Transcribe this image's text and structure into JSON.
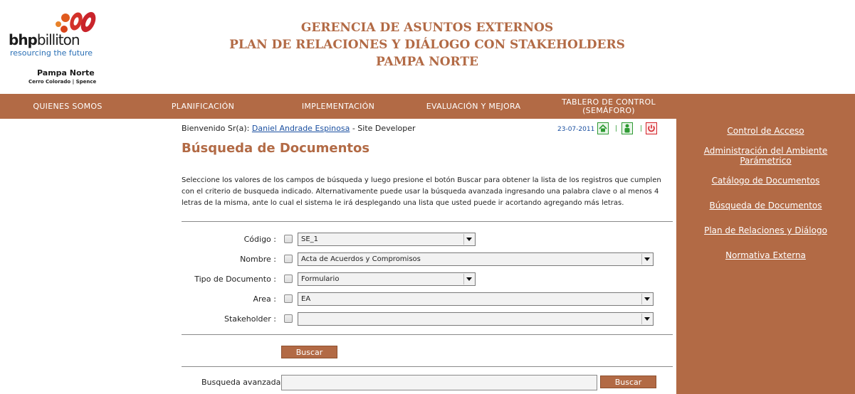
{
  "brand": {
    "logo_word_bold": "bhp",
    "logo_word_rest": "billiton",
    "tagline": "resourcing the future",
    "site_name": "Pampa Norte",
    "site_sub": "Cerro Colorado | Spence"
  },
  "header": {
    "title_line1": "GERENCIA DE ASUNTOS EXTERNOS",
    "title_line2": "PLAN DE RELACIONES Y DIÁLOGO CON STAKEHOLDERS",
    "title_line3": "PAMPA NORTE"
  },
  "nav": {
    "quienes": "QUIENES SOMOS",
    "planificacion": "PLANIFICACIÓN",
    "implementacion": "IMPLEMENTACIÓN",
    "evaluacion": "EVALUACIÓN Y MEJORA",
    "tablero_line1": "TABLERO DE CONTROL",
    "tablero_line2": "(SEMÁFORO)"
  },
  "user": {
    "greeting": "Bienvenido Sr(a):",
    "name": "Daniel Andrade Espinosa",
    "role": "- Site Developer",
    "date": "23-07-2011"
  },
  "toolbar": {
    "separator": "|",
    "icons": [
      "home-icon",
      "user-icon",
      "power-icon"
    ]
  },
  "page": {
    "title": "Búsqueda de Documentos",
    "description": "Seleccione los valores de los campos de búsqueda y luego presione el botón Buscar para obtener la lista de los registros que cumplen con el criterio de busqueda indicado. Alternativamente puede usar la búsqueda avanzada ingresando una palabra clave o al menos 4 letras de la misma, ante lo cual el sistema le irá desplegando una lista que usted puede ir acortando agregando más letras."
  },
  "form": {
    "codigo_label": "Código :",
    "codigo_value": "SE_1",
    "nombre_label": "Nombre :",
    "nombre_value": "Acta de Acuerdos y Compromisos",
    "tipo_label": "Tipo de Documento :",
    "tipo_value": "Formulario",
    "area_label": "Area :",
    "area_value": "EA",
    "stakeholder_label": "Stakeholder :",
    "stakeholder_value": "",
    "buscar_label": "Buscar"
  },
  "advanced": {
    "label": "Busqueda avanzada",
    "value": "",
    "buscar_label": "Buscar"
  },
  "sidebar": {
    "control": "Control de Acceso",
    "admin_line1": "Administración del Ambiente",
    "admin_line2": "Parámetrico",
    "catalogo": "Catálogo de Documentos",
    "busqueda": "Búsqueda de Documentos",
    "plan": "Plan de Relaciones y Diálogo",
    "normativa": "Normativa Externa"
  },
  "colors": {
    "brand_brown": "#b26a45",
    "link_blue": "#1a4fa0",
    "icon_green": "#2e9a33",
    "icon_red": "#d3232a"
  }
}
